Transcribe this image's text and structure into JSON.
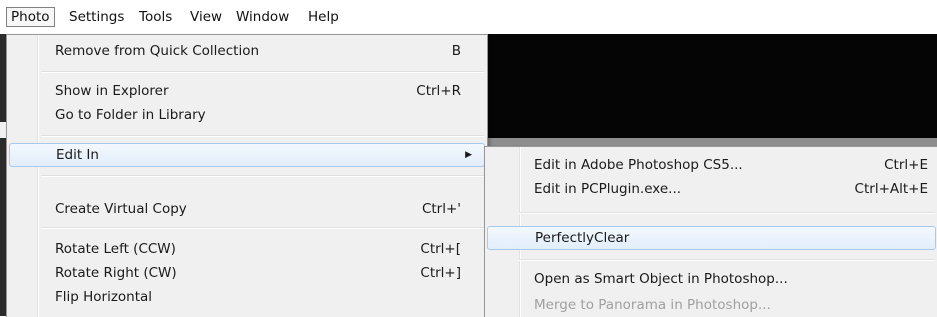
{
  "menubar": {
    "items": [
      "Photo",
      "Settings",
      "Tools",
      "View",
      "Window",
      "Help"
    ]
  },
  "photo_menu": {
    "items": [
      {
        "label": "Remove from Quick Collection",
        "shortcut": "B"
      },
      {
        "label": "Show in Explorer",
        "shortcut": "Ctrl+R"
      },
      {
        "label": "Go to Folder in Library",
        "shortcut": ""
      },
      {
        "label": "Edit In",
        "shortcut": ""
      },
      {
        "label": "Create Virtual Copy",
        "shortcut": "Ctrl+'"
      },
      {
        "label": "Rotate Left (CCW)",
        "shortcut": "Ctrl+["
      },
      {
        "label": "Rotate Right (CW)",
        "shortcut": "Ctrl+]"
      },
      {
        "label": "Flip Horizontal",
        "shortcut": ""
      }
    ]
  },
  "edit_in_submenu": {
    "items": [
      {
        "label": "Edit in Adobe Photoshop CS5...",
        "shortcut": "Ctrl+E"
      },
      {
        "label": "Edit in PCPlugin.exe...",
        "shortcut": "Ctrl+Alt+E"
      },
      {
        "label": "PerfectlyClear",
        "shortcut": ""
      },
      {
        "label": "Open as Smart Object in Photoshop...",
        "shortcut": ""
      },
      {
        "label": "Merge to Panorama in Photoshop...",
        "shortcut": ""
      }
    ]
  },
  "icons": {
    "submenu_arrow": "chevron-right-icon"
  },
  "colors": {
    "highlight_border": "#a8c9ee",
    "menu_bg": "#f0f0f0",
    "disabled_text": "#a0a0a0"
  }
}
